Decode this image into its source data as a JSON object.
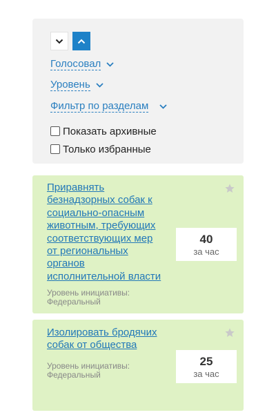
{
  "filters": {
    "sort_desc_icon": "chevron-down-icon",
    "sort_asc_icon": "chevron-up-icon",
    "voted_label": "Голосовал",
    "level_label": "Уровень",
    "section_filter_label": "Фильтр по разделам",
    "show_archived_label": "Показать архивные",
    "only_favorites_label": "Только избранные",
    "show_archived_checked": false,
    "only_favorites_checked": false
  },
  "initiatives": [
    {
      "title": "Приравнять безнадзорных собак к социально-опасным животным, требующих соответствующих мер от региональных органов исполнительной власти",
      "level_label": "Уровень инициативы:",
      "level_value": "Федеральный",
      "rate": "40",
      "rate_unit": "за час",
      "favorite": false
    },
    {
      "title": "Изолировать бродячих собак от общества",
      "level_label": "Уровень инициативы:",
      "level_value": "Федеральный",
      "rate": "25",
      "rate_unit": "за час",
      "favorite": false
    }
  ],
  "colors": {
    "accent": "#1e82c8",
    "link": "#2278b8",
    "card_bg": "#dff2c5",
    "panel_bg": "#f2f2f2",
    "star": "#c9c9c9"
  }
}
